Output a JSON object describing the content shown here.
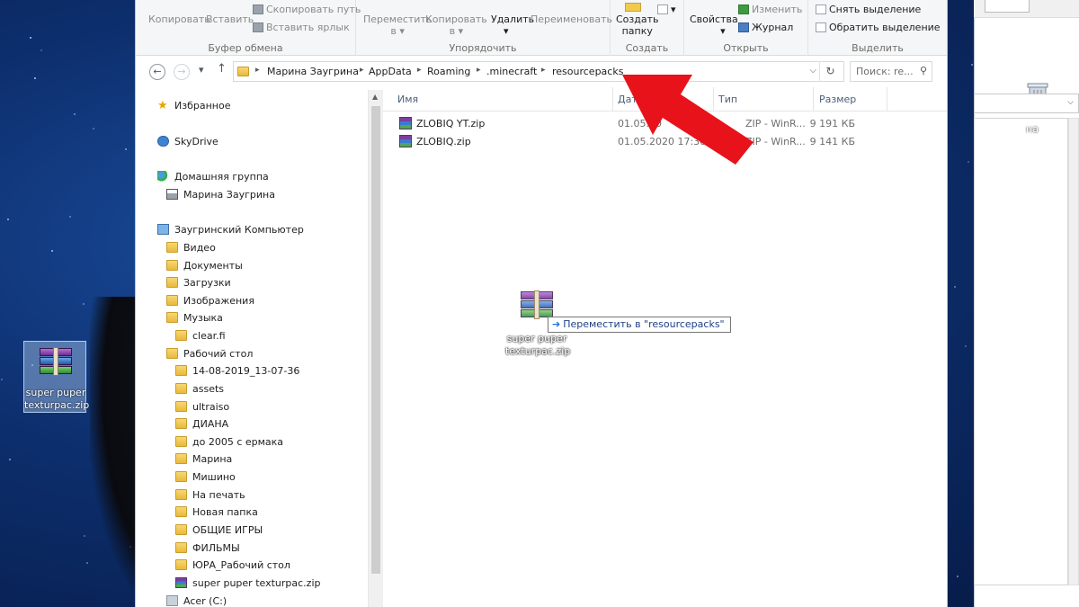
{
  "ribbon": {
    "clipboard": {
      "copy": "Копировать",
      "paste": "Вставить",
      "copy_path": "Скопировать путь",
      "paste_shortcut": "Вставить ярлык",
      "group": "Буфер обмена"
    },
    "organize": {
      "move_to_1": "Переместить",
      "move_to_2": "в",
      "copy_to_1": "Копировать",
      "copy_to_2": "в",
      "delete": "Удалить",
      "rename": "Переименовать",
      "group": "Упорядочить"
    },
    "new": {
      "new_folder_1": "Создать",
      "new_folder_2": "папку",
      "group": "Создать"
    },
    "open": {
      "properties": "Свойства",
      "edit": "Изменить",
      "history": "Журнал",
      "group": "Открыть"
    },
    "select": {
      "select_none": "Снять выделение",
      "invert_selection": "Обратить выделение",
      "group": "Выделить"
    }
  },
  "address": {
    "crumbs": [
      "Марина Заугрина",
      "AppData",
      "Roaming",
      ".minecraft",
      "resourcepacks"
    ],
    "search_placeholder": "Поиск: re..."
  },
  "nav": {
    "favorites": "Избранное",
    "skydrive": "SkyDrive",
    "homegroup": "Домашняя группа",
    "homegroup_user": "Марина Заугрина",
    "computer": "Заугринский Компьютер",
    "libraries": [
      "Видео",
      "Документы",
      "Загрузки",
      "Изображения",
      "Музыка"
    ],
    "music_child": "clear.fi",
    "desktop": "Рабочий стол",
    "desktop_folders": [
      "14-08-2019_13-07-36",
      "assets",
      "ultraiso",
      "ДИАНА",
      "до 2005 с ермака",
      "Марина",
      "Мишино",
      "На печать",
      "Новая папка",
      "ОБЩИЕ ИГРЫ",
      "ФИЛЬМЫ",
      "ЮРА_Рабочий стол"
    ],
    "desktop_zip": "super puper texturpac.zip",
    "drive": "Acer (C:)"
  },
  "columns": {
    "name": "Имя",
    "date": "Дата",
    "type": "Тип",
    "size": "Размер"
  },
  "files": [
    {
      "name": "ZLOBIQ YT.zip",
      "date": "01.05.20",
      "type": "ZIP - WinR...",
      "size": "9 191 КБ"
    },
    {
      "name": "ZLOBIQ.zip",
      "date": "01.05.2020 17:30",
      "type": "ZIP - WinR...",
      "size": "9 141 КБ"
    }
  ],
  "drag": {
    "label": "super puper texturpac.zip",
    "tooltip": "Переместить в \"resourcepacks\""
  },
  "desktop_icon": {
    "label": "super puper texturpac.zip"
  },
  "right_window": {
    "fragment": "на"
  },
  "colors": {
    "arrow": "#e8121b",
    "desktop_blue": "#0d2f6e"
  }
}
